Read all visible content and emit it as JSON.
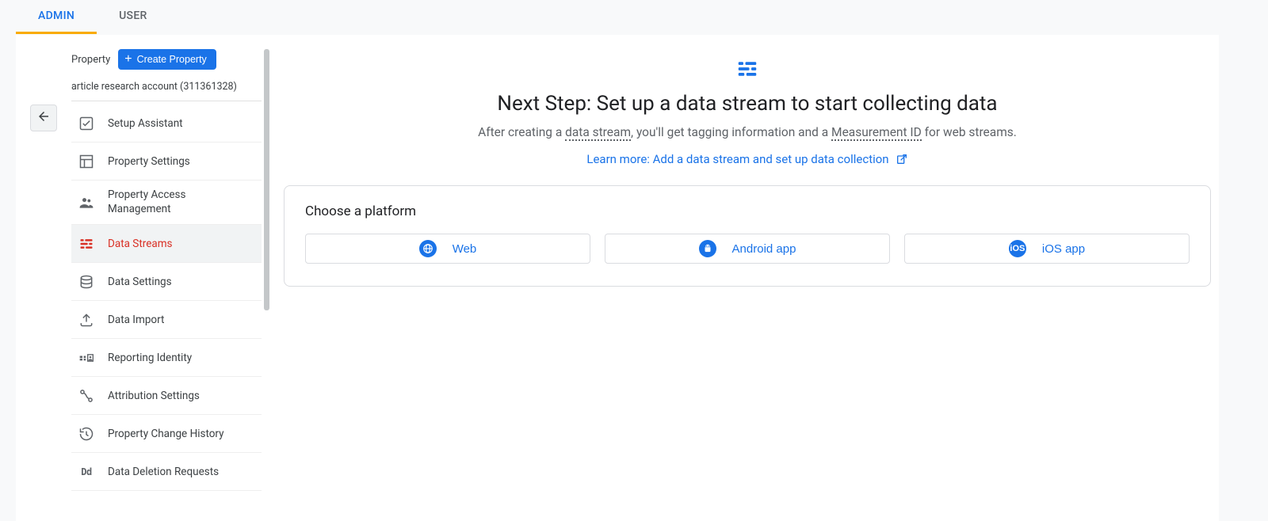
{
  "tabs": {
    "admin": "ADMIN",
    "user": "USER"
  },
  "sidebar": {
    "property_label": "Property",
    "create_button": "Create Property",
    "account_name": "article research account (311361328)",
    "items": [
      {
        "label": "Setup Assistant"
      },
      {
        "label": "Property Settings"
      },
      {
        "label": "Property Access Management"
      },
      {
        "label": "Data Streams"
      },
      {
        "label": "Data Settings"
      },
      {
        "label": "Data Import"
      },
      {
        "label": "Reporting Identity"
      },
      {
        "label": "Attribution Settings"
      },
      {
        "label": "Property Change History"
      },
      {
        "label": "Data Deletion Requests"
      }
    ]
  },
  "main": {
    "title": "Next Step: Set up a data stream to start collecting data",
    "sub_prefix": "After creating a ",
    "sub_term1": "data stream",
    "sub_mid": ", you'll get tagging information and a ",
    "sub_term2": "Measurement ID",
    "sub_suffix": " for web streams.",
    "learn_more": "Learn more: Add a data stream and set up data collection",
    "choose_platform": "Choose a platform",
    "platforms": {
      "web": "Web",
      "android": "Android app",
      "ios": "iOS app"
    }
  }
}
